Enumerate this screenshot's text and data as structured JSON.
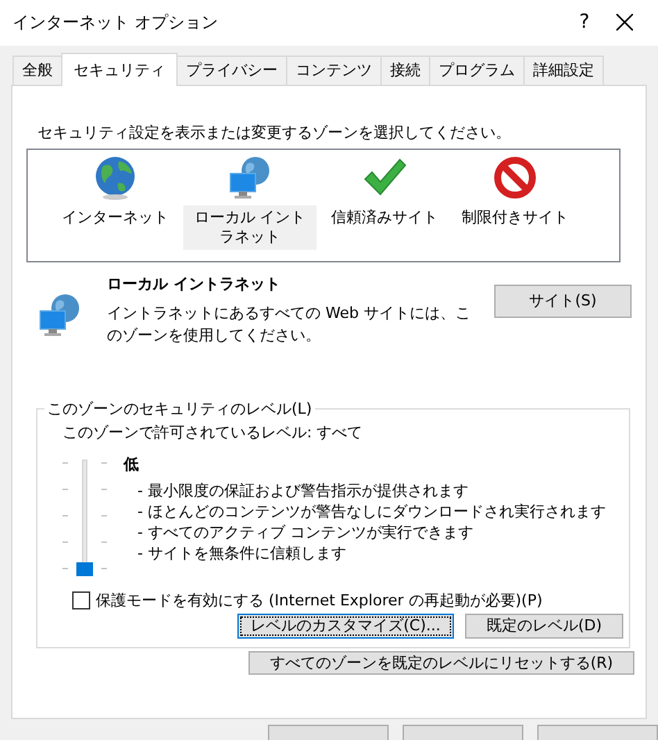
{
  "window": {
    "title": "インターネット オプション",
    "help": "?"
  },
  "tabs": [
    {
      "label": "全般",
      "selected": false
    },
    {
      "label": "セキュリティ",
      "selected": true
    },
    {
      "label": "プライバシー",
      "selected": false
    },
    {
      "label": "コンテンツ",
      "selected": false
    },
    {
      "label": "接続",
      "selected": false
    },
    {
      "label": "プログラム",
      "selected": false
    },
    {
      "label": "詳細設定",
      "selected": false
    }
  ],
  "instruction": "セキュリティ設定を表示または変更するゾーンを選択してください。",
  "zones": [
    {
      "kind": "globe",
      "label": "インターネット",
      "selected": false
    },
    {
      "kind": "intranet",
      "label": "ローカル イントラネット",
      "selected": true
    },
    {
      "kind": "trusted",
      "label": "信頼済みサイト",
      "selected": false
    },
    {
      "kind": "restricted",
      "label": "制限付きサイト",
      "selected": false
    }
  ],
  "zone_detail": {
    "title": "ローカル イントラネット",
    "description": "イントラネットにあるすべての Web サイトには、このゾーンを使用してください。",
    "sites_button": "サイト(S)"
  },
  "security_level": {
    "legend": "このゾーンのセキュリティのレベル(L)",
    "allowed": "このゾーンで許可されているレベル: すべて",
    "level": 0,
    "level_name": "低",
    "bullets": [
      "- 最小限度の保証および警告指示が提供されます",
      "- ほとんどのコンテンツが警告なしにダウンロードされ実行されます",
      "- すべてのアクティブ コンテンツが実行できます",
      "- サイトを無条件に信頼します"
    ],
    "protected_mode": {
      "label": "保護モードを有効にする (Internet Explorer の再起動が必要)(P)",
      "checked": false
    },
    "custom_button": {
      "label": "レベルのカスタマイズ(C)...",
      "focused": true
    },
    "default_button": {
      "label": "既定のレベル(D)",
      "focused": false
    }
  },
  "reset_button": "すべてのゾーンを既定のレベルにリセットする(R)",
  "footer_buttons": [
    {
      "kind": "button"
    },
    {
      "kind": "button"
    },
    {
      "kind": "button"
    }
  ]
}
